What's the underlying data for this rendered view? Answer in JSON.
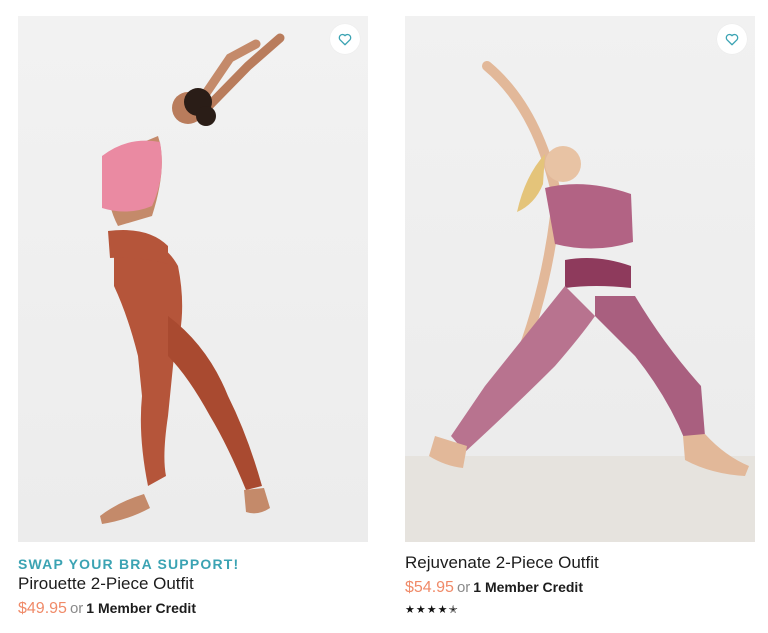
{
  "products": [
    {
      "promo": "SWAP YOUR BRA SUPPORT!",
      "title": "Pirouette 2-Piece Outfit",
      "price": "$49.95",
      "or_text": "or",
      "credit": "1 Member Credit",
      "image_alt": "Model in pink sports bra and rust flare leggings, arching backward",
      "favorite_icon": "heart-outline-icon"
    },
    {
      "promo": "",
      "title": "Rejuvenate 2-Piece Outfit",
      "price": "$54.95",
      "or_text": "or",
      "credit": "1 Member Credit",
      "rating": 4.5,
      "stars": [
        "★",
        "★",
        "★",
        "★",
        "✭"
      ],
      "image_alt": "Model in patterned berry crop top and leggings in a side-bend lunge",
      "favorite_icon": "heart-outline-icon"
    }
  ],
  "colors": {
    "promo": "#3ba3b3",
    "price": "#f08a68",
    "heart": "#3ba3b3"
  }
}
